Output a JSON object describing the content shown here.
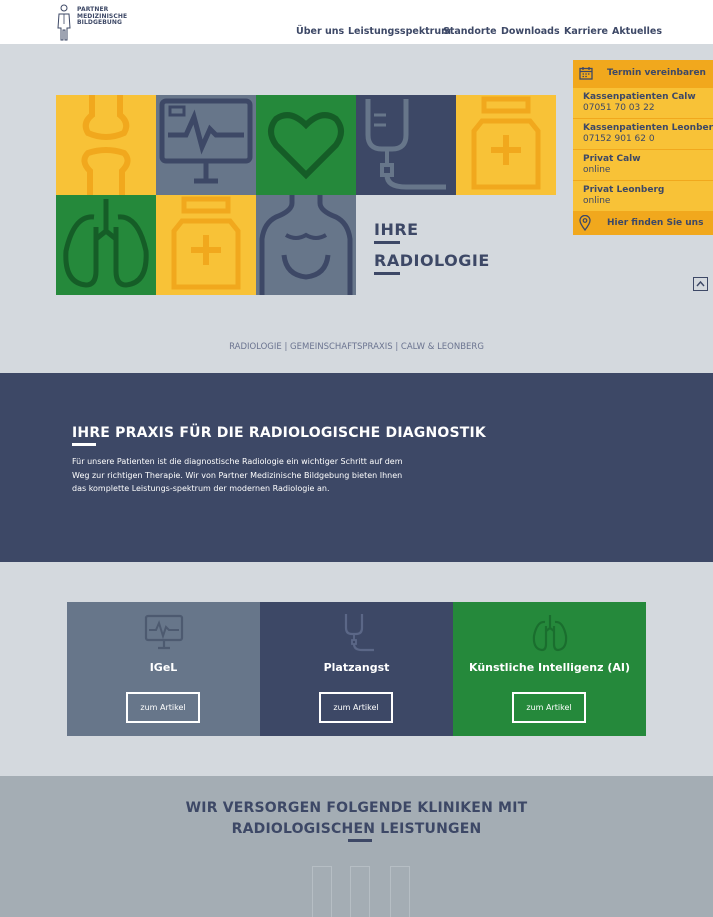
{
  "logo": {
    "lines": [
      "PARTNER",
      "MEDIZINISCHE",
      "BILDGEBUNG"
    ]
  },
  "nav": {
    "items": [
      "Über uns",
      "Leistungsspektrum",
      "Standorte",
      "Downloads",
      "Karriere",
      "Aktuelles"
    ]
  },
  "hero": {
    "title_line1": "IHRE",
    "title_line2": "RADIOLOGIE",
    "subline": "RADIOLOGIE | GEMEINSCHAFTSPRAXIS | CALW & LEONBERG"
  },
  "widget": {
    "header_label": "Termin vereinbaren",
    "items": [
      {
        "title": "Kassenpatienten Calw",
        "value": "07051 70 03 22"
      },
      {
        "title": "Kassenpatienten Leonberg",
        "value": "07152 901 62 0"
      },
      {
        "title": "Privat Calw",
        "value": "online"
      },
      {
        "title": "Privat Leonberg",
        "value": "online"
      }
    ],
    "footer_label": "Hier finden Sie uns"
  },
  "intro": {
    "heading": "IHRE PRAXIS FÜR DIE RADIOLOGISCHE DIAGNOSTIK",
    "text": "Für unsere Patienten ist die diagnostische Radiologie ein wichtiger Schritt auf dem Weg zur richtigen Therapie. Wir von Partner Medizinische Bildgebung  bieten Ihnen das komplette Leistungs-spektrum der modernen Radiologie an."
  },
  "cards": [
    {
      "title": "IGeL",
      "button": "zum Artikel",
      "icon": "monitor-icon",
      "color": "#67768a"
    },
    {
      "title": "Platzangst",
      "button": "zum Artikel",
      "icon": "iv-bag-icon",
      "color": "#3d4866"
    },
    {
      "title": "Künstliche Intelligenz (AI)",
      "button": "zum Artikel",
      "icon": "lungs-icon",
      "color": "#25893b"
    }
  ],
  "clinics": {
    "heading_line1": "WIR VERSORGEN FOLGENDE KLINIKEN MIT",
    "heading_line2": "RADIOLOGISCHEN LEISTUNGEN"
  },
  "colors": {
    "navy": "#3d4866",
    "yellow": "#f8c237",
    "orange": "#f1a81d",
    "green": "#25893b",
    "slate": "#67768a",
    "light": "#d4d9de"
  }
}
